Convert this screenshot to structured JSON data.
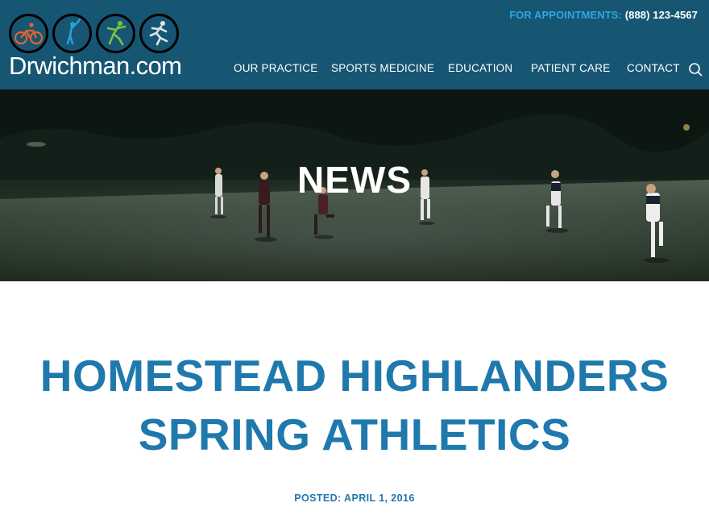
{
  "header": {
    "logo_text": "Drwichman.com",
    "logo_icons": [
      "cycling-icon",
      "golf-icon",
      "dance-icon",
      "running-icon"
    ],
    "appointments_label": "FOR APPOINTMENTS:",
    "appointments_phone": "(888) 123-4567",
    "nav": [
      {
        "label": "OUR PRACTICE"
      },
      {
        "label": "SPORTS MEDICINE"
      },
      {
        "label": "EDUCATION"
      },
      {
        "label": "PATIENT CARE"
      },
      {
        "label": "CONTACT"
      }
    ],
    "search_icon": "search-icon"
  },
  "hero": {
    "title": "NEWS"
  },
  "article": {
    "title_line1": "HOMESTEAD HIGHLANDERS",
    "title_line2": "SPRING ATHLETICS",
    "posted": "POSTED: APRIL 1, 2016"
  },
  "colors": {
    "header_bg": "#165673",
    "accent_blue": "#2ea7e0",
    "title_blue": "#1f79ad"
  }
}
